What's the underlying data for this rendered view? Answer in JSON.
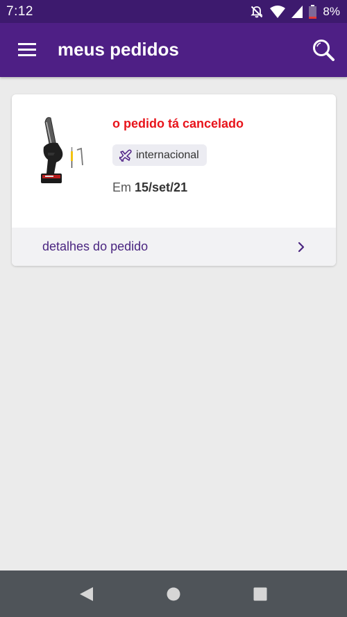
{
  "status_bar": {
    "time": "7:12",
    "battery": "8%",
    "icons": [
      "notifications-off-icon",
      "wifi-icon",
      "signal-icon",
      "battery-icon"
    ]
  },
  "app_bar": {
    "title": "meus pedidos",
    "menu_icon": "menu-icon",
    "search_icon": "search-icon"
  },
  "order": {
    "status": "o pedido tá cancelado",
    "status_color": "#e8141b",
    "tag": "internacional",
    "tag_icon": "airplane-icon",
    "date_prefix": "Em",
    "date": "15/set/21",
    "details_label": "detalhes do pedido",
    "product_image": "chainsaw-product-image"
  },
  "colors": {
    "primary": "#4e1f85",
    "status_bar": "#3d1a6e",
    "link": "#4a2580"
  },
  "nav_bar": {
    "buttons": [
      "back-icon",
      "home-icon",
      "recents-icon"
    ]
  }
}
